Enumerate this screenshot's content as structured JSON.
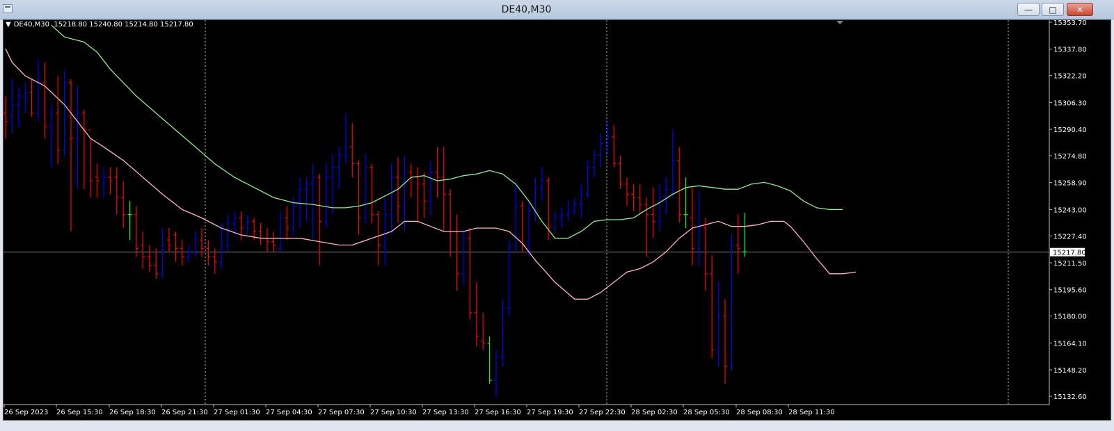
{
  "window": {
    "title": "DE40,M30",
    "minimize_glyph": "—",
    "maximize_glyph": "□",
    "close_glyph": "✕"
  },
  "chart": {
    "info_triangle": "▼",
    "symbol": "DE40,M30",
    "ohlc": "15218.80 15240.80 15214.80 15217.80",
    "current_price_label": "15217.80",
    "colors": {
      "background": "#000000",
      "bull": "#0000ff",
      "bear": "#ff0000",
      "doji": "#00ff00",
      "ma_fast": "#ffb6c1",
      "ma_slow": "#90ee90",
      "price_line": "#808080",
      "text": "#ffffff"
    }
  },
  "chart_data": {
    "type": "ohlc",
    "price_ticks": [
      "15353.70",
      "15337.80",
      "15322.20",
      "15306.30",
      "15290.40",
      "15274.80",
      "15258.90",
      "15243.00",
      "15227.40",
      "15211.50",
      "15195.60",
      "15180.00",
      "15164.10",
      "15148.20",
      "15132.60"
    ],
    "time_ticks": [
      "26 Sep 2023",
      "26 Sep 15:30",
      "26 Sep 18:30",
      "26 Sep 21:30",
      "27 Sep 01:30",
      "27 Sep 04:30",
      "27 Sep 07:30",
      "27 Sep 10:30",
      "27 Sep 13:30",
      "27 Sep 16:30",
      "27 Sep 19:30",
      "27 Sep 22:30",
      "28 Sep 02:30",
      "28 Sep 05:30",
      "28 Sep 08:30",
      "28 Sep 11:30"
    ],
    "ylim": [
      15132.6,
      15353.7
    ],
    "bars": [
      [
        15300,
        15310,
        15285,
        15295
      ],
      [
        15298,
        15320,
        15288,
        15305
      ],
      [
        15305,
        15315,
        15292,
        15310
      ],
      [
        15310,
        15318,
        15300,
        15312
      ],
      [
        15312,
        15320,
        15298,
        15300
      ],
      [
        15300,
        15332,
        15295,
        15318
      ],
      [
        15318,
        15330,
        15285,
        15292
      ],
      [
        15292,
        15305,
        15268,
        15300
      ],
      [
        15300,
        15322,
        15270,
        15278
      ],
      [
        15278,
        15325,
        15275,
        15318
      ],
      [
        15318,
        15320,
        15230,
        15285
      ],
      [
        15285,
        15316,
        15255,
        15300
      ],
      [
        15300,
        15302,
        15255,
        15290
      ],
      [
        15290,
        15285,
        15250,
        15260
      ],
      [
        15262,
        15270,
        15250,
        15260
      ],
      [
        15258,
        15268,
        15250,
        15262
      ],
      [
        15262,
        15268,
        15252,
        15260
      ],
      [
        15262,
        15268,
        15240,
        15250
      ],
      [
        15250,
        15260,
        15232,
        15240
      ],
      [
        15240,
        15248,
        15225,
        15240
      ],
      [
        15240,
        15245,
        15215,
        15220
      ],
      [
        15222,
        15230,
        15208,
        15215
      ],
      [
        15215,
        15222,
        15206,
        15210
      ],
      [
        15210,
        15220,
        15202,
        15205
      ],
      [
        15205,
        15232,
        15202,
        15222
      ],
      [
        15225,
        15232,
        15218,
        15222
      ],
      [
        15228,
        15230,
        15212,
        15220
      ],
      [
        15220,
        15225,
        15210,
        15215
      ],
      [
        15215,
        15222,
        15212,
        15218
      ],
      [
        15218,
        15230,
        15215,
        15225
      ],
      [
        15225,
        15232,
        15215,
        15220
      ],
      [
        15220,
        15225,
        15210,
        15215
      ],
      [
        15215,
        15220,
        15205,
        15212
      ],
      [
        15212,
        15235,
        15208,
        15222
      ],
      [
        15222,
        15240,
        15218,
        15235
      ],
      [
        15235,
        15242,
        15228,
        15238
      ],
      [
        15238,
        15242,
        15225,
        15232
      ],
      [
        15232,
        15240,
        15228,
        15236
      ],
      [
        15236,
        15238,
        15225,
        15230
      ],
      [
        15230,
        15235,
        15222,
        15226
      ],
      [
        15226,
        15232,
        15218,
        15224
      ],
      [
        15224,
        15230,
        15218,
        15222
      ],
      [
        15220,
        15242,
        15218,
        15238
      ],
      [
        15238,
        15245,
        15225,
        15232
      ],
      [
        15232,
        15250,
        15228,
        15245
      ],
      [
        15248,
        15262,
        15232,
        15255
      ],
      [
        15255,
        15262,
        15236,
        15258
      ],
      [
        15258,
        15270,
        15225,
        15262
      ],
      [
        15262,
        15264,
        15210,
        15236
      ],
      [
        15236,
        15270,
        15232,
        15262
      ],
      [
        15262,
        15276,
        15240,
        15268
      ],
      [
        15268,
        15280,
        15255,
        15275
      ],
      [
        15275,
        15300,
        15270,
        15280
      ],
      [
        15280,
        15294,
        15262,
        15270
      ],
      [
        15270,
        15272,
        15228,
        15238
      ],
      [
        15238,
        15276,
        15235,
        15268
      ],
      [
        15268,
        15270,
        15235,
        15240
      ],
      [
        15240,
        15242,
        15210,
        15222
      ],
      [
        15222,
        15250,
        15210,
        15240
      ],
      [
        15240,
        15270,
        15228,
        15262
      ],
      [
        15262,
        15274,
        15235,
        15245
      ],
      [
        15245,
        15275,
        15230,
        15265
      ],
      [
        15265,
        15270,
        15250,
        15262
      ],
      [
        15262,
        15268,
        15235,
        15258
      ],
      [
        15258,
        15265,
        15238,
        15248
      ],
      [
        15248,
        15272,
        15240,
        15265
      ],
      [
        15265,
        15280,
        15250,
        15262
      ],
      [
        15262,
        15280,
        15230,
        15252
      ],
      [
        15252,
        15255,
        15215,
        15230
      ],
      [
        15230,
        15240,
        15195,
        15205
      ],
      [
        15205,
        15230,
        15198,
        15226
      ],
      [
        15226,
        15232,
        15178,
        15182
      ],
      [
        15182,
        15200,
        15162,
        15168
      ],
      [
        15165,
        15182,
        15160,
        15164
      ],
      [
        15164,
        15168,
        15140,
        15142
      ],
      [
        15142,
        15160,
        15132,
        15156
      ],
      [
        15156,
        15190,
        15150,
        15185
      ],
      [
        15185,
        15225,
        15180,
        15221
      ],
      [
        15221,
        15258,
        15218,
        15245
      ],
      [
        15245,
        15248,
        15218,
        15222
      ],
      [
        15222,
        15248,
        15215,
        15242
      ],
      [
        15242,
        15262,
        15236,
        15256
      ],
      [
        15256,
        15268,
        15248,
        15260
      ],
      [
        15260,
        15262,
        15225,
        15232
      ],
      [
        15232,
        15242,
        15230,
        15238
      ],
      [
        15238,
        15244,
        15232,
        15240
      ],
      [
        15240,
        15248,
        15236,
        15242
      ],
      [
        15242,
        15250,
        15240,
        15246
      ],
      [
        15246,
        15258,
        15238,
        15252
      ],
      [
        15252,
        15272,
        15250,
        15268
      ],
      [
        15268,
        15278,
        15262,
        15275
      ],
      [
        15275,
        15288,
        15268,
        15282
      ],
      [
        15282,
        15295,
        15275,
        15286
      ],
      [
        15286,
        15293,
        15268,
        15270
      ],
      [
        15270,
        15275,
        15255,
        15258
      ],
      [
        15258,
        15262,
        15245,
        15252
      ],
      [
        15252,
        15258,
        15242,
        15250
      ],
      [
        15250,
        15258,
        15240,
        15246
      ],
      [
        15246,
        15250,
        15215,
        15240
      ],
      [
        15240,
        15256,
        15226,
        15236
      ],
      [
        15236,
        15258,
        15230,
        15250
      ],
      [
        15250,
        15262,
        15240,
        15255
      ],
      [
        15255,
        15290,
        15250,
        15272
      ],
      [
        15272,
        15280,
        15235,
        15240
      ],
      [
        15240,
        15262,
        15232,
        15240
      ],
      [
        15238,
        15256,
        15210,
        15220
      ],
      [
        15220,
        15254,
        15210,
        15232
      ],
      [
        15232,
        15238,
        15195,
        15205
      ],
      [
        15205,
        15216,
        15155,
        15160
      ],
      [
        15160,
        15200,
        15150,
        15180
      ],
      [
        15180,
        15190,
        15140,
        15150
      ],
      [
        15150,
        15228,
        15148,
        15222
      ],
      [
        15222,
        15240,
        15205,
        15220
      ],
      [
        15218,
        15241,
        15215,
        15218
      ]
    ],
    "ma_fast": [
      [
        0,
        15338
      ],
      [
        1,
        15330
      ],
      [
        3,
        15322
      ],
      [
        6,
        15316
      ],
      [
        9,
        15305
      ],
      [
        11,
        15295
      ],
      [
        13,
        15285
      ],
      [
        15,
        15280
      ],
      [
        18,
        15272
      ],
      [
        21,
        15262
      ],
      [
        24,
        15252
      ],
      [
        27,
        15243
      ],
      [
        30,
        15238
      ],
      [
        33,
        15232
      ],
      [
        36,
        15228
      ],
      [
        39,
        15226
      ],
      [
        42,
        15226
      ],
      [
        45,
        15226
      ],
      [
        48,
        15224
      ],
      [
        51,
        15222
      ],
      [
        53,
        15222
      ],
      [
        56,
        15226
      ],
      [
        59,
        15230
      ],
      [
        61,
        15236
      ],
      [
        63,
        15236
      ],
      [
        65,
        15233
      ],
      [
        67,
        15230
      ],
      [
        70,
        15230
      ],
      [
        72,
        15232
      ],
      [
        75,
        15232
      ],
      [
        77,
        15230
      ],
      [
        79,
        15223
      ],
      [
        81,
        15213
      ],
      [
        84,
        15200
      ],
      [
        87,
        15190
      ],
      [
        89,
        15190
      ],
      [
        91,
        15194
      ],
      [
        93,
        15200
      ],
      [
        95,
        15206
      ],
      [
        97,
        15208
      ],
      [
        99,
        15212
      ],
      [
        101,
        15218
      ],
      [
        103,
        15226
      ],
      [
        105,
        15232
      ],
      [
        107,
        15234
      ],
      [
        109,
        15236
      ],
      [
        111,
        15233
      ],
      [
        113,
        15233
      ],
      [
        115,
        15234
      ],
      [
        117,
        15236
      ],
      [
        119,
        15236
      ],
      [
        120,
        15233
      ],
      [
        122,
        15224
      ],
      [
        124,
        15214
      ],
      [
        126,
        15205
      ],
      [
        128,
        15205
      ],
      [
        130,
        15206
      ]
    ],
    "ma_slow": [
      [
        7,
        15352
      ],
      [
        9,
        15345
      ],
      [
        12,
        15342
      ],
      [
        14,
        15336
      ],
      [
        16,
        15326
      ],
      [
        18,
        15318
      ],
      [
        20,
        15310
      ],
      [
        23,
        15300
      ],
      [
        26,
        15290
      ],
      [
        29,
        15280
      ],
      [
        32,
        15270
      ],
      [
        35,
        15262
      ],
      [
        38,
        15256
      ],
      [
        41,
        15250
      ],
      [
        44,
        15247
      ],
      [
        47,
        15246
      ],
      [
        50,
        15244
      ],
      [
        52,
        15244
      ],
      [
        54,
        15245
      ],
      [
        56,
        15247
      ],
      [
        58,
        15251
      ],
      [
        60,
        15255
      ],
      [
        62,
        15262
      ],
      [
        64,
        15263
      ],
      [
        66,
        15260
      ],
      [
        68,
        15261
      ],
      [
        70,
        15263
      ],
      [
        72,
        15264
      ],
      [
        74,
        15266
      ],
      [
        76,
        15264
      ],
      [
        78,
        15258
      ],
      [
        80,
        15248
      ],
      [
        82,
        15236
      ],
      [
        84,
        15226
      ],
      [
        86,
        15226
      ],
      [
        88,
        15230
      ],
      [
        90,
        15236
      ],
      [
        92,
        15237
      ],
      [
        94,
        15237
      ],
      [
        96,
        15238
      ],
      [
        98,
        15243
      ],
      [
        100,
        15247
      ],
      [
        102,
        15252
      ],
      [
        104,
        15256
      ],
      [
        106,
        15257
      ],
      [
        108,
        15256
      ],
      [
        110,
        15255
      ],
      [
        112,
        15255
      ],
      [
        114,
        15258
      ],
      [
        116,
        15259
      ],
      [
        118,
        15257
      ],
      [
        120,
        15254
      ],
      [
        122,
        15248
      ],
      [
        124,
        15244
      ],
      [
        126,
        15243
      ],
      [
        128,
        15243
      ]
    ]
  }
}
